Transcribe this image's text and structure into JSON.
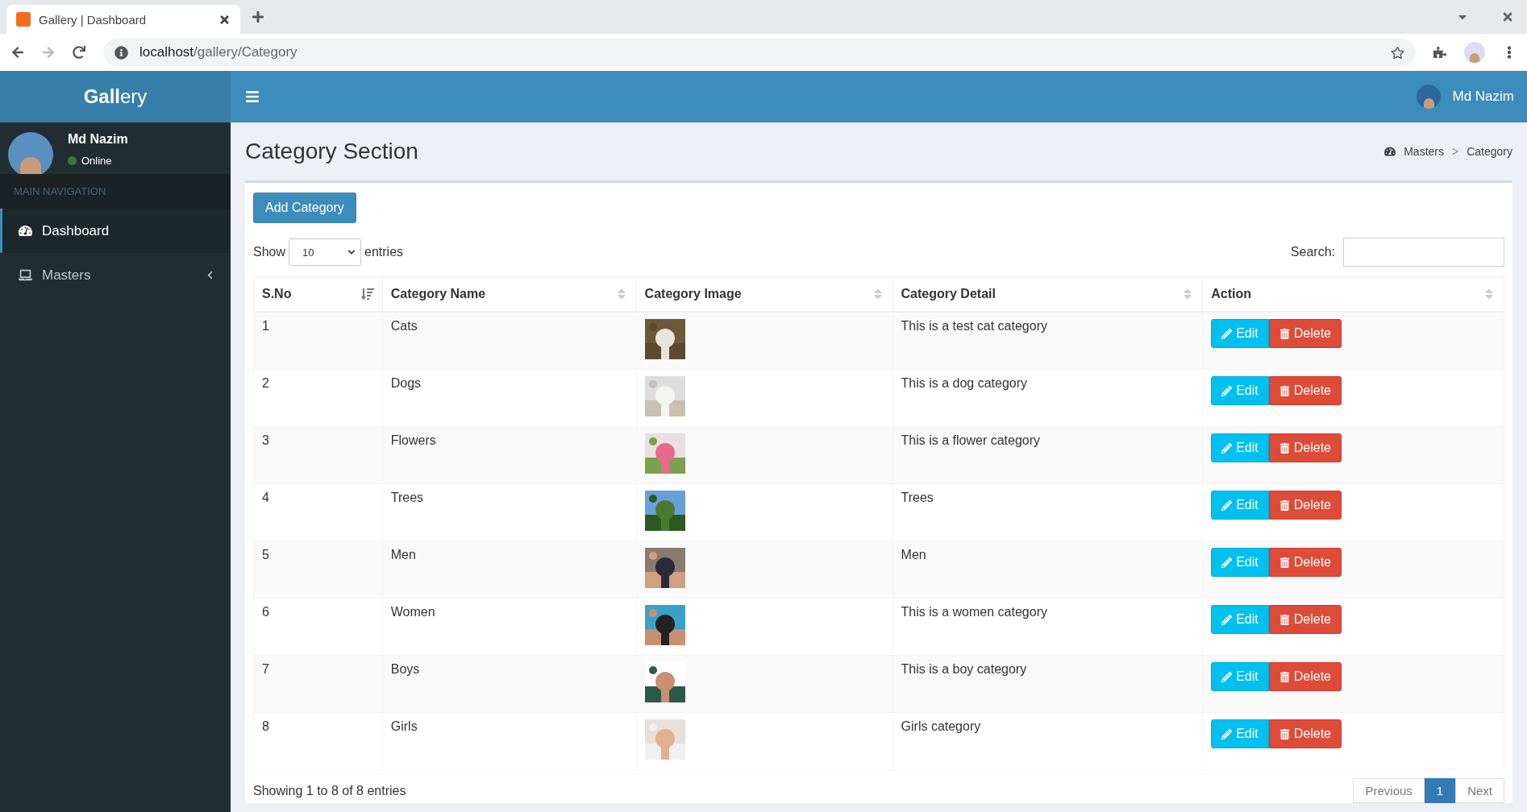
{
  "browser": {
    "tab_title": "Gallery | Dashboard",
    "url_host": "localhost",
    "url_path": "/gallery/Category"
  },
  "header": {
    "logo_bold": "Gall",
    "logo_rest": "ery",
    "user_name": "Md Nazim"
  },
  "sidebar": {
    "user_name": "Md Nazim",
    "status": "Online",
    "section_label": "MAIN NAVIGATION",
    "items": [
      {
        "label": "Dashboard",
        "selected": true,
        "expandable": false
      },
      {
        "label": "Masters",
        "selected": false,
        "expandable": true
      }
    ]
  },
  "page": {
    "title": "Category Section",
    "breadcrumb": [
      "Masters",
      "Category"
    ],
    "breadcrumb_separator": ">"
  },
  "toolbar": {
    "add_button": "Add Category",
    "show_label": "Show",
    "entries_value": "10",
    "entries_label": "entries",
    "search_label": "Search:"
  },
  "table": {
    "columns": [
      {
        "label": "S.No",
        "sorted": true
      },
      {
        "label": "Category Name",
        "sorted": false
      },
      {
        "label": "Category Image",
        "sorted": false
      },
      {
        "label": "Category Detail",
        "sorted": false
      },
      {
        "label": "Action",
        "sorted": false
      }
    ],
    "rows": [
      {
        "sno": "1",
        "name": "Cats",
        "detail": "This is a test cat category",
        "edit_label": "Edit",
        "delete_label": "Delete"
      },
      {
        "sno": "2",
        "name": "Dogs",
        "detail": "This is a dog category",
        "edit_label": "Edit",
        "delete_label": "Delete"
      },
      {
        "sno": "3",
        "name": "Flowers",
        "detail": "This is a flower category",
        "edit_label": "Edit",
        "delete_label": "Delete"
      },
      {
        "sno": "4",
        "name": "Trees",
        "detail": "Trees",
        "edit_label": "Edit",
        "delete_label": "Delete"
      },
      {
        "sno": "5",
        "name": "Men",
        "detail": "Men",
        "edit_label": "Edit",
        "delete_label": "Delete"
      },
      {
        "sno": "6",
        "name": "Women",
        "detail": "This is a women category",
        "edit_label": "Edit",
        "delete_label": "Delete"
      },
      {
        "sno": "7",
        "name": "Boys",
        "detail": "This is a boy category",
        "edit_label": "Edit",
        "delete_label": "Delete"
      },
      {
        "sno": "8",
        "name": "Girls",
        "detail": "Girls category",
        "edit_label": "Edit",
        "delete_label": "Delete"
      }
    ]
  },
  "footer": {
    "info": "Showing 1 to 8 of 8 entries",
    "pages": [
      {
        "label": "Previous",
        "selected": false
      },
      {
        "label": "1",
        "selected": true
      },
      {
        "label": "Next",
        "selected": false
      }
    ]
  }
}
